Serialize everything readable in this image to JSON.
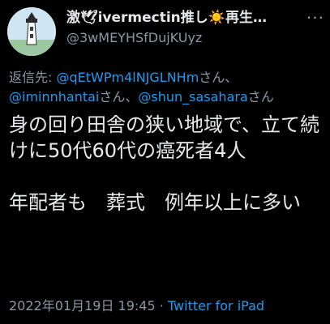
{
  "author": {
    "display_name": "激🕊ivermectin推し☀️再生…",
    "handle": "@3wMEYHSfDujKUyz",
    "avatar_icon": "lighthouse-avatar-icon"
  },
  "more_icon": "more-options-icon",
  "reply_to": {
    "prefix": "返信先: ",
    "mentions": [
      {
        "user": "@qEtWPm4lNJGLNHm",
        "suffix": "さん、"
      },
      {
        "user": "@iminnhantai",
        "suffix": "さん、"
      },
      {
        "user": "@shun_sasahara",
        "suffix": "さん"
      }
    ]
  },
  "tweet": {
    "text": "身の回り田舎の狭い地域で、立て続けに50代60代の癌死者4人\n\n年配者も　葬式　例年以上に多い"
  },
  "meta": {
    "timestamp": "2022年01月19日 19:45",
    "separator": " · ",
    "source": "Twitter for iPad"
  },
  "colors": {
    "background": "#000000",
    "text": "#e7e9ea",
    "secondary": "#8b98a5",
    "link": "#1d9bf0"
  }
}
